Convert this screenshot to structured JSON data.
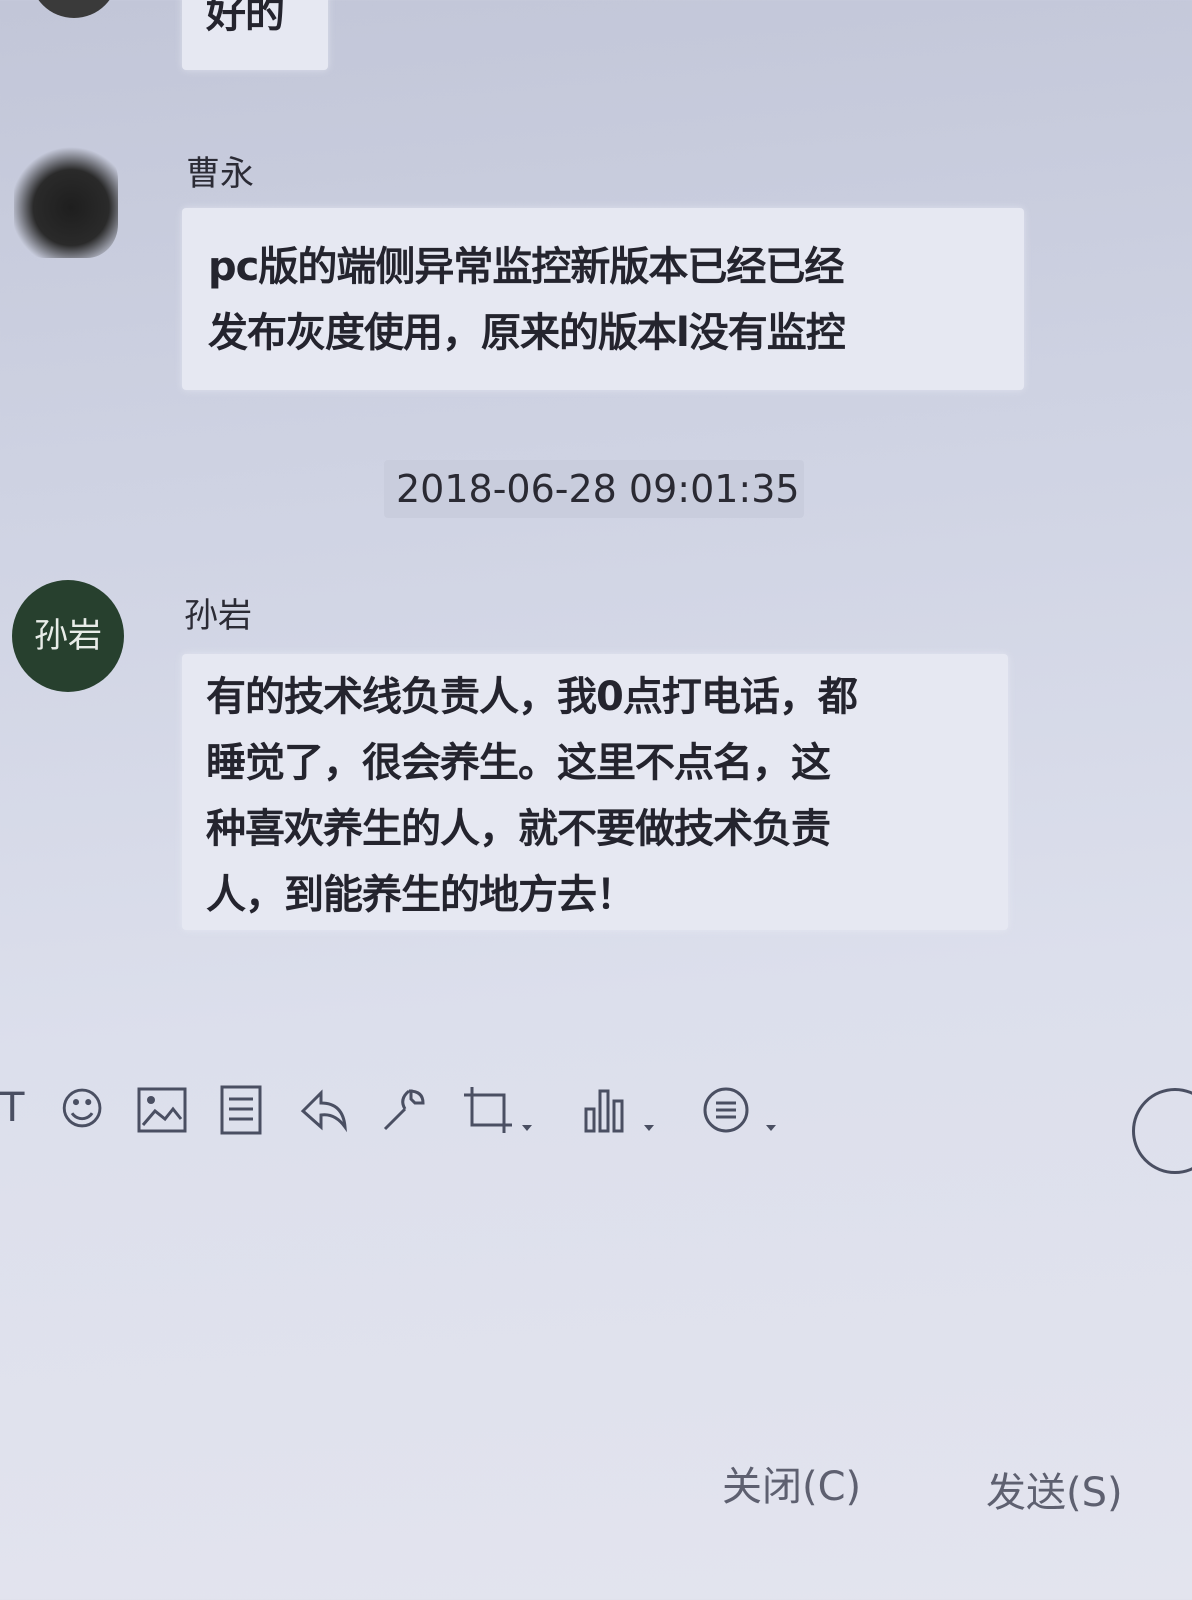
{
  "messages": [
    {
      "text": "好的"
    },
    {
      "sender": "曹永",
      "lines": [
        "pc版的端侧异常监控新版本已经已经",
        "发布灰度使用，原来的版本l没有监控"
      ]
    },
    {
      "sender": "孙岩",
      "avatar_text": "孙岩",
      "lines": [
        "有的技术线负责人，我0点打电话，都",
        "睡觉了，很会养生。这里不点名，这",
        "种喜欢养生的人，就不要做技术负责",
        "人，到能养生的地方去！"
      ]
    }
  ],
  "timestamp": "2018-06-28 09:01:35",
  "footer": {
    "close_label": "关闭(C)",
    "send_label": "发送(S)"
  },
  "toolbar": {
    "icons": [
      "font-icon",
      "emoji-icon",
      "image-icon",
      "file-icon",
      "shake-icon",
      "remote-assist-icon",
      "screenshot-icon",
      "voice-message-icon",
      "chat-history-icon"
    ]
  },
  "colors": {
    "background": "#cfd3e3",
    "bubble": "#e6e8f2",
    "avatar_green": "#27402e"
  }
}
